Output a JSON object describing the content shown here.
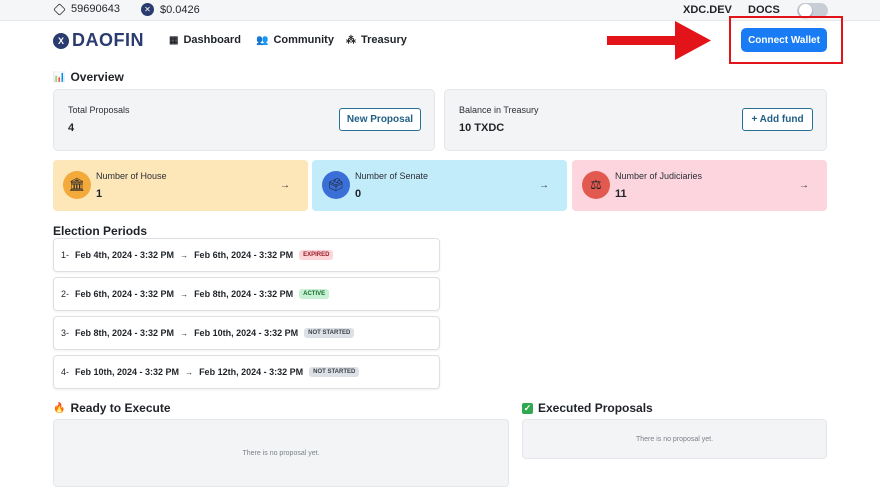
{
  "topbar": {
    "block_number": "59690643",
    "xdc_price": "$0.0426",
    "xdc_dev_link": "XDC.DEV",
    "docs_link": "DOCS"
  },
  "nav": {
    "logo_mark": "X",
    "logo_text": "DAOFIN",
    "items": [
      "Dashboard",
      "Community",
      "Treasury"
    ],
    "connect_wallet": "Connect Wallet"
  },
  "overview": {
    "title": "Overview",
    "total_proposals_label": "Total Proposals",
    "total_proposals_value": "4",
    "new_proposal_button": "New Proposal",
    "treasury_label": "Balance in Treasury",
    "treasury_value": "10 TXDC",
    "add_fund_button": "+ Add fund"
  },
  "stats": [
    {
      "label": "Number of House",
      "value": "1",
      "color": "#fde6b8"
    },
    {
      "label": "Number of Senate",
      "value": "0",
      "color": "#c2ecfa"
    },
    {
      "label": "Number of Judiciaries",
      "value": "11",
      "color": "#fdd5de"
    }
  ],
  "elections": {
    "title": "Election Periods",
    "periods": [
      {
        "index": "1-",
        "start": "Feb 4th, 2024 - 3:32 PM",
        "end": "Feb 6th, 2024 - 3:32 PM",
        "status": "EXPIRED"
      },
      {
        "index": "2-",
        "start": "Feb 6th, 2024 - 3:32 PM",
        "end": "Feb 8th, 2024 - 3:32 PM",
        "status": "ACTIVE"
      },
      {
        "index": "3-",
        "start": "Feb 8th, 2024 - 3:32 PM",
        "end": "Feb 10th, 2024 - 3:32 PM",
        "status": "NOT STARTED"
      },
      {
        "index": "4-",
        "start": "Feb 10th, 2024 - 3:32 PM",
        "end": "Feb 12th, 2024 - 3:32 PM",
        "status": "NOT STARTED"
      }
    ]
  },
  "ready": {
    "title": "Ready to Execute",
    "empty": "There is no proposal yet."
  },
  "executed": {
    "title": "Executed Proposals",
    "empty": "There is no proposal yet."
  },
  "colors": {
    "accent": "#1a7cf5",
    "brand": "#2a3b6f",
    "highlight": "#e3131a"
  }
}
